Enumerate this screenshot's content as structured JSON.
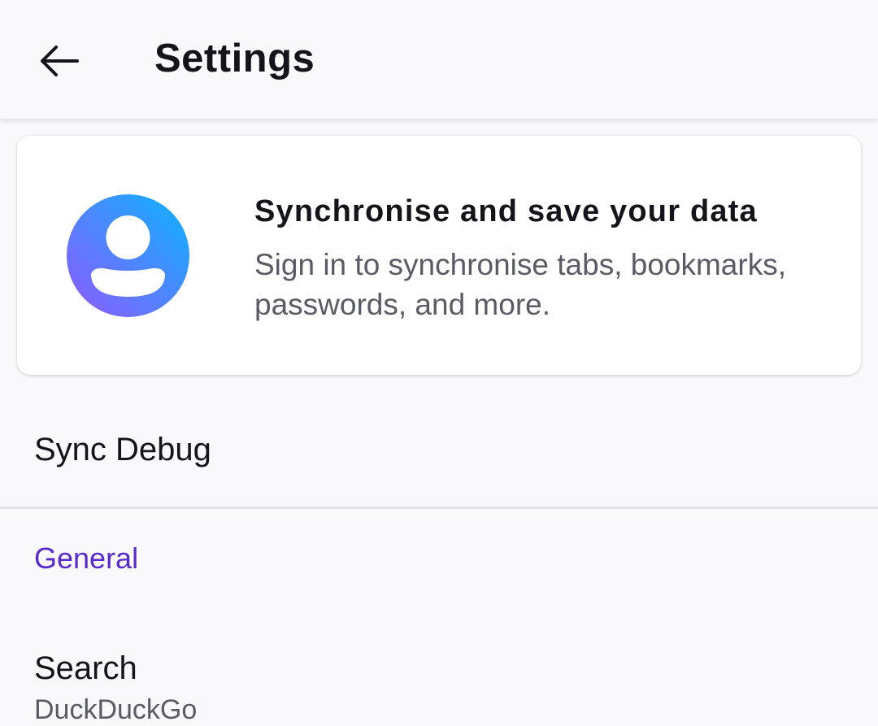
{
  "toolbar": {
    "title": "Settings",
    "back_icon": "arrow-left-icon"
  },
  "account_card": {
    "avatar_icon": "account-avatar-icon",
    "title": "Synchronise and save your data",
    "subtitle": "Sign in to synchronise tabs, bookmarks, passwords, and more."
  },
  "preferences": {
    "sync_debug": "Sync Debug",
    "general_header": "General",
    "search": {
      "label": "Search",
      "summary": "DuckDuckGo"
    }
  },
  "colors": {
    "accent": "#592acb",
    "background": "#f9f9fb",
    "avatar_gradient_start": "#9059ff",
    "avatar_gradient_end": "#0ab4ff"
  }
}
